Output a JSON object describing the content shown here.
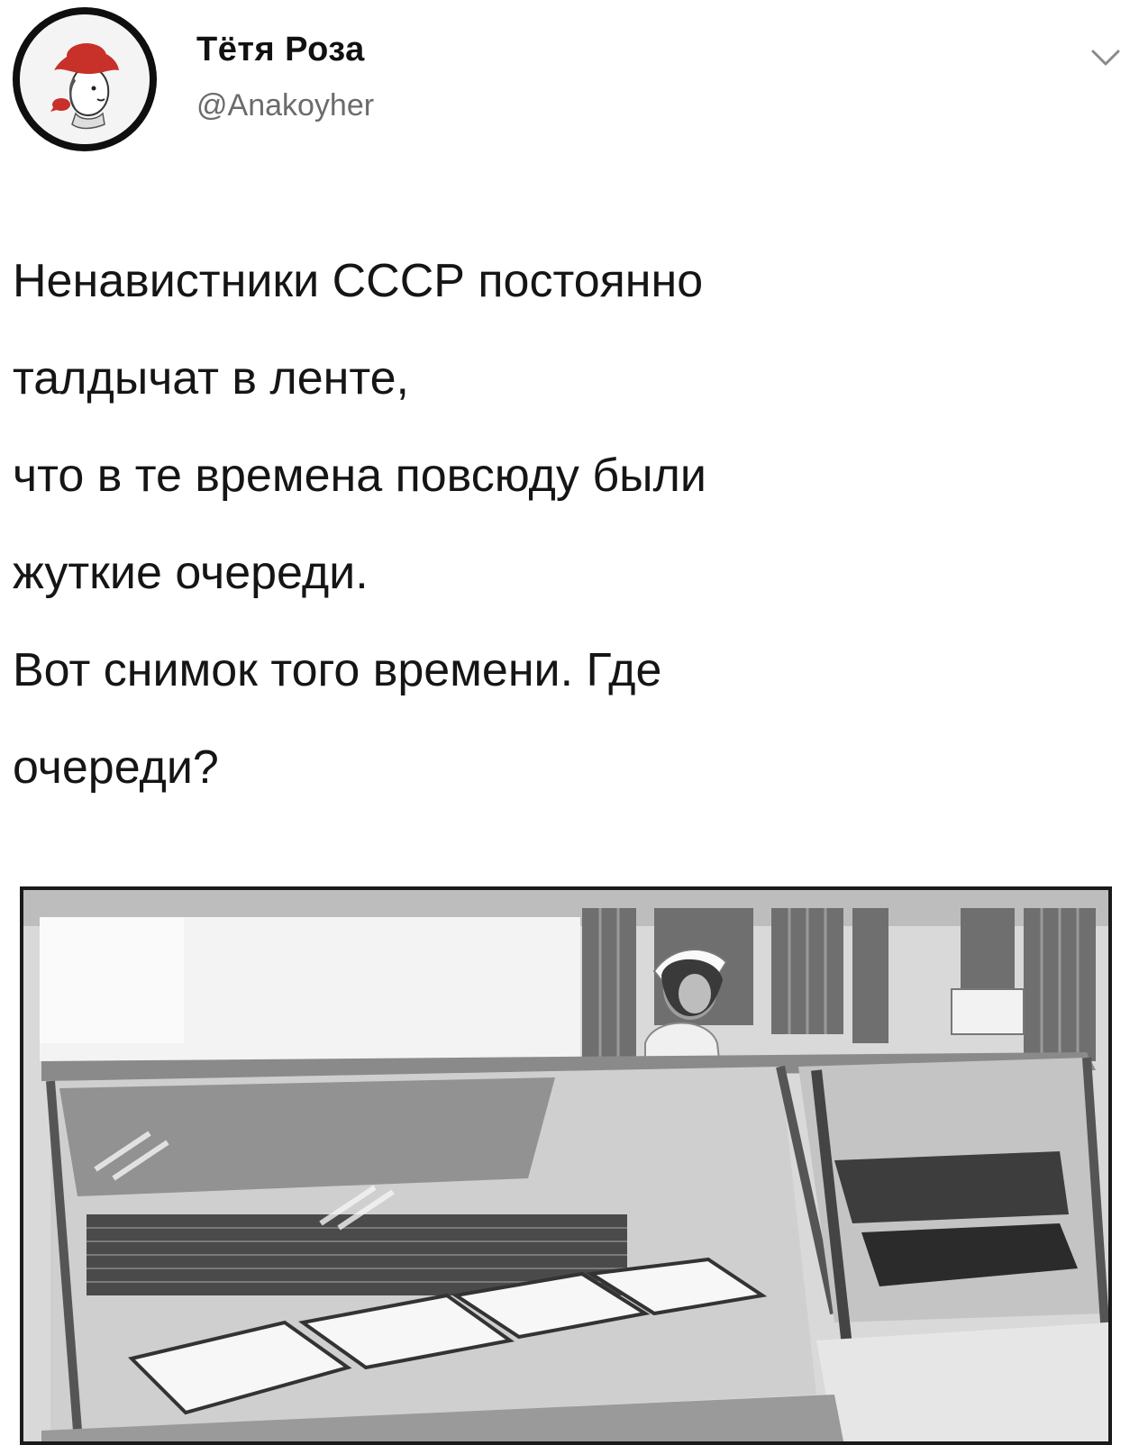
{
  "tweet": {
    "author_name": "Тётя Роза",
    "author_handle": "@Anakoyher",
    "text_lines": [
      "Ненавистники СССР постоянно",
      "талдычат в ленте,",
      "что в те времена повсюду были",
      "жуткие очереди.",
      "Вот снимок того времени. Где",
      "очереди?"
    ]
  },
  "icons": {
    "avatar": "avatar-woman-red-hat",
    "menu": "chevron-down-icon"
  },
  "colors": {
    "hat": "#c8302a",
    "text": "#151515",
    "handle": "#6b6b6b"
  }
}
